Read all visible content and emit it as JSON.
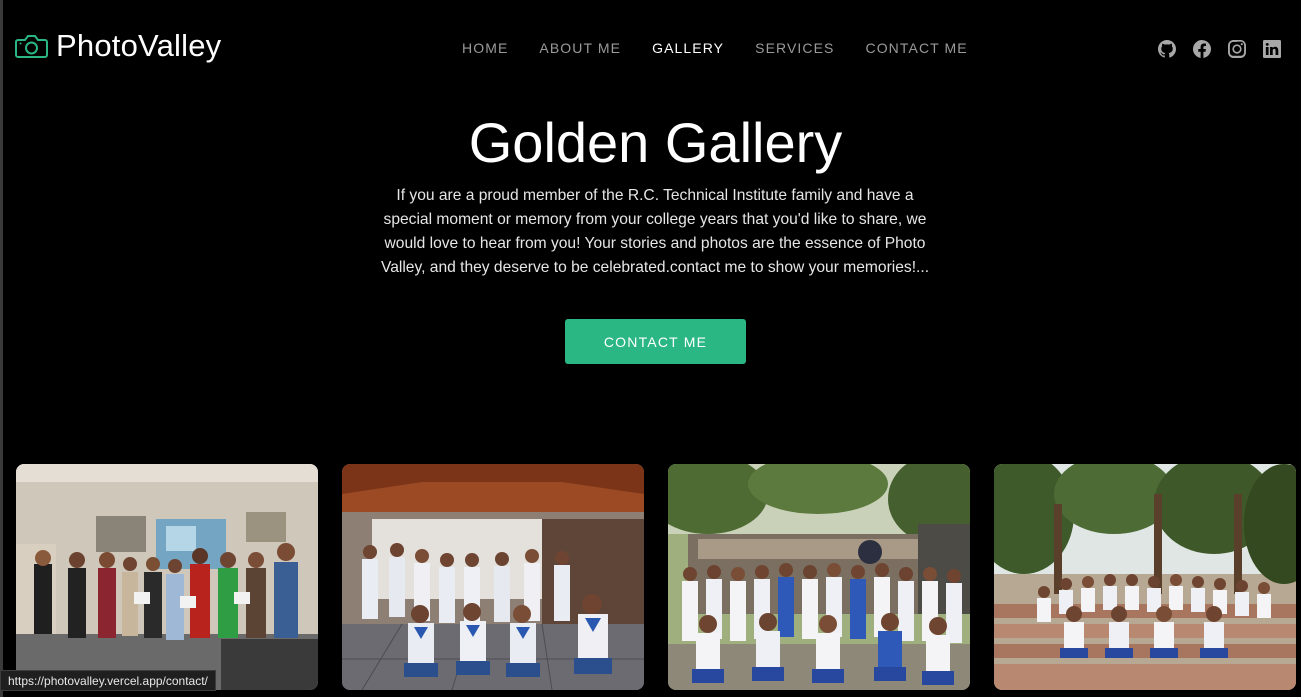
{
  "brand": {
    "name": "PhotoValley",
    "icon": "camera-icon",
    "color": "#2ab783"
  },
  "nav": {
    "items": [
      {
        "label": "HOME",
        "active": false
      },
      {
        "label": "ABOUT ME",
        "active": false
      },
      {
        "label": "GALLERY",
        "active": true
      },
      {
        "label": "SERVICES",
        "active": false
      },
      {
        "label": "CONTACT ME",
        "active": false
      }
    ]
  },
  "social": [
    {
      "icon": "github-icon"
    },
    {
      "icon": "facebook-icon"
    },
    {
      "icon": "instagram-icon"
    },
    {
      "icon": "linkedin-icon"
    }
  ],
  "hero": {
    "title": "Golden Gallery",
    "text": "If you are a proud member of the R.C. Technical Institute family and have a special moment or memory from your college years that you'd like to share, we would love to hear from you! Your stories and photos are the essence of Photo Valley, and they deserve to be celebrated.contact me to show your memories!...",
    "cta_label": "CONTACT ME",
    "accent": "#2ab783"
  },
  "gallery": {
    "photos": [
      {
        "name": "photo-classroom-group"
      },
      {
        "name": "photo-hall-group"
      },
      {
        "name": "photo-outdoor-group"
      },
      {
        "name": "photo-steps-group"
      }
    ]
  },
  "status": {
    "url": "https://photovalley.vercel.app/contact/"
  }
}
